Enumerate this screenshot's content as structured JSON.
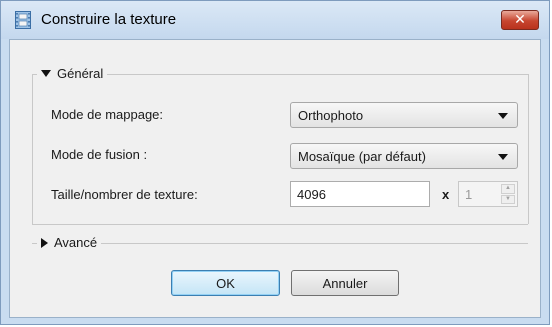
{
  "window": {
    "title": "Construire la texture"
  },
  "general": {
    "header": "Général",
    "mapping_label": "Mode de mappage:",
    "mapping_value": "Orthophoto",
    "blending_label": "Mode de fusion :",
    "blending_value": "Mosaïque (par défaut)",
    "texture_label": "Taille/nombrer de texture:",
    "texture_size": "4096",
    "times": "x",
    "texture_count": "1"
  },
  "advanced": {
    "header": "Avancé"
  },
  "buttons": {
    "ok": "OK",
    "cancel": "Annuler"
  },
  "icons": {
    "app": "film-icon",
    "close": "close-icon"
  },
  "close_glyph": "✕",
  "colors": {
    "close_button": "#c7452f",
    "title_bar": "#c9dcf0",
    "default_button_border": "#3c7fb1"
  }
}
